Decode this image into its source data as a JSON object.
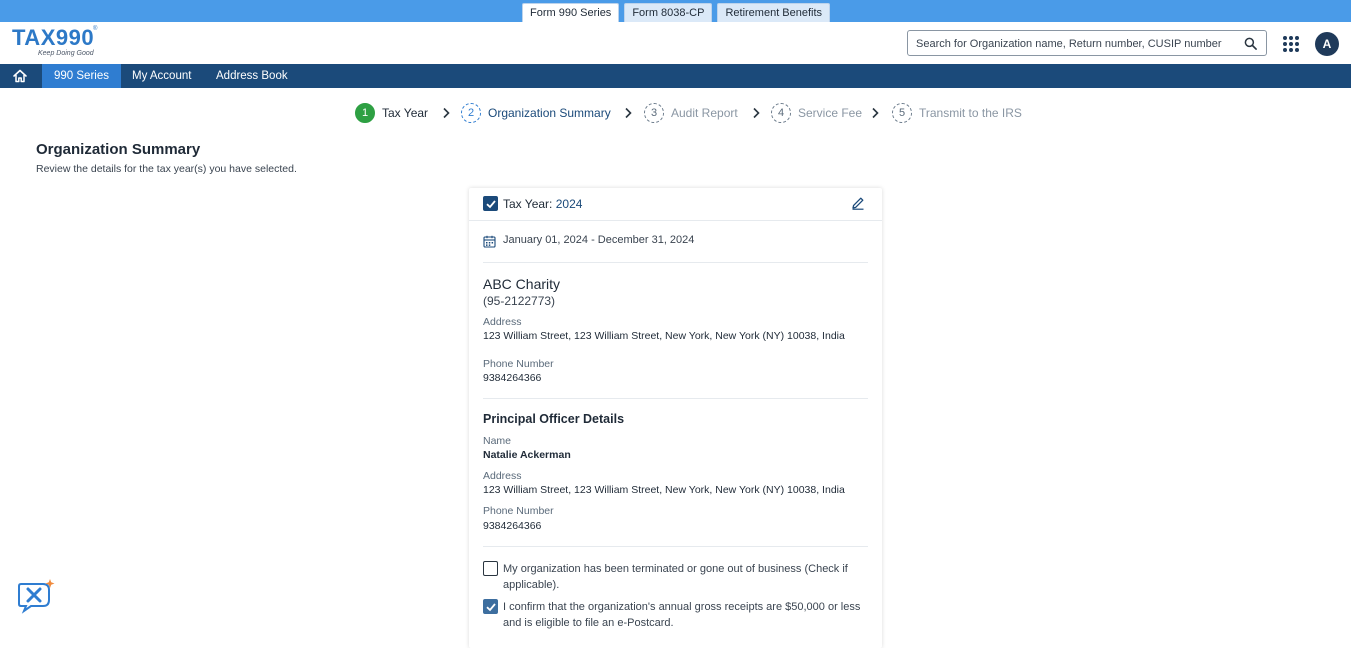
{
  "product_tabs": [
    "Form 990 Series",
    "Form 8038-CP",
    "Retirement Benefits"
  ],
  "logo": {
    "word": "TAX990",
    "tagline": "Keep Doing Good",
    "reg": "®"
  },
  "search": {
    "placeholder": "Search for Organization name, Return number, CUSIP number"
  },
  "user": {
    "avatar_initial": "A"
  },
  "nav": {
    "items": [
      "990 Series",
      "My Account",
      "Address Book"
    ]
  },
  "stepper": {
    "steps": [
      {
        "num": "1",
        "label": "Tax Year",
        "state": "done"
      },
      {
        "num": "2",
        "label": "Organization Summary",
        "state": "current"
      },
      {
        "num": "3",
        "label": "Audit Report",
        "state": "pending"
      },
      {
        "num": "4",
        "label": "Service Fee",
        "state": "pending"
      },
      {
        "num": "5",
        "label": "Transmit to the IRS",
        "state": "pending"
      }
    ]
  },
  "page": {
    "title": "Organization Summary",
    "subtitle": "Review the details for the tax year(s) you have selected."
  },
  "card": {
    "tax_year_label": "Tax Year: ",
    "tax_year_value": "2024",
    "date_range": "January 01, 2024 - December 31, 2024",
    "org_name": "ABC Charity",
    "ein": "(95-2122773)",
    "address_label": "Address",
    "address": "123 William Street, 123 William Street, New York, New York (NY) 10038, India",
    "phone_label": "Phone Number",
    "phone": "9384264366",
    "officer_title": "Principal Officer Details",
    "officer_name_label": "Name",
    "officer_name": "Natalie Ackerman",
    "officer_address_label": "Address",
    "officer_address": "123 William Street, 123 William Street, New York, New York (NY) 10038, India",
    "officer_phone_label": "Phone Number",
    "officer_phone": "9384264366",
    "terminated_text": "My organization has been terminated or gone out of business (Check if applicable).",
    "confirm_text": "I confirm that the organization's annual gross receipts are $50,000 or less and is eligible to file an e-Postcard."
  },
  "colors": {
    "primary": "#1b4a7a",
    "accent": "#2f7dd1",
    "success": "#2ea043",
    "topbar": "#4a9be8"
  }
}
